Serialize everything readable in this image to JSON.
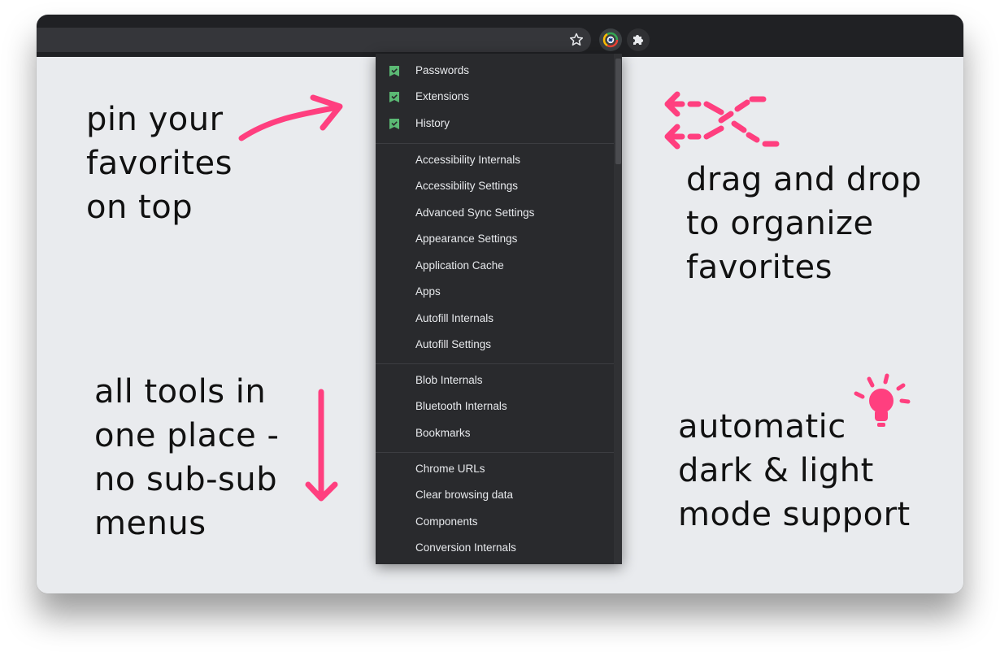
{
  "captions": {
    "pin": "pin your\nfavorites\non top",
    "drag": "drag and drop\nto organize\nfavorites",
    "tools": "all tools in\none place -\nno sub-sub\nmenus",
    "mode": "automatic\ndark & light\nmode support"
  },
  "toolbar": {
    "bookmark_icon": "star-icon",
    "extension_icon": "chrome-extension-icon",
    "puzzle_icon": "puzzle-icon"
  },
  "menu": {
    "favorites": [
      {
        "label": "Passwords"
      },
      {
        "label": "Extensions"
      },
      {
        "label": "History"
      }
    ],
    "group_a": [
      {
        "label": "Accessibility Internals"
      },
      {
        "label": "Accessibility Settings"
      },
      {
        "label": "Advanced Sync Settings"
      },
      {
        "label": "Appearance Settings"
      },
      {
        "label": "Application Cache"
      },
      {
        "label": "Apps"
      },
      {
        "label": "Autofill Internals"
      },
      {
        "label": "Autofill Settings"
      }
    ],
    "group_b": [
      {
        "label": "Blob Internals"
      },
      {
        "label": "Bluetooth Internals"
      },
      {
        "label": "Bookmarks"
      }
    ],
    "group_c": [
      {
        "label": "Chrome URLs"
      },
      {
        "label": "Clear browsing data"
      },
      {
        "label": "Components"
      },
      {
        "label": "Conversion Internals"
      }
    ]
  },
  "colors": {
    "accent_pink": "#ff3f7f",
    "favorite_green": "#5bb974",
    "menu_bg": "#292a2d",
    "page_bg": "#e9ebee"
  }
}
